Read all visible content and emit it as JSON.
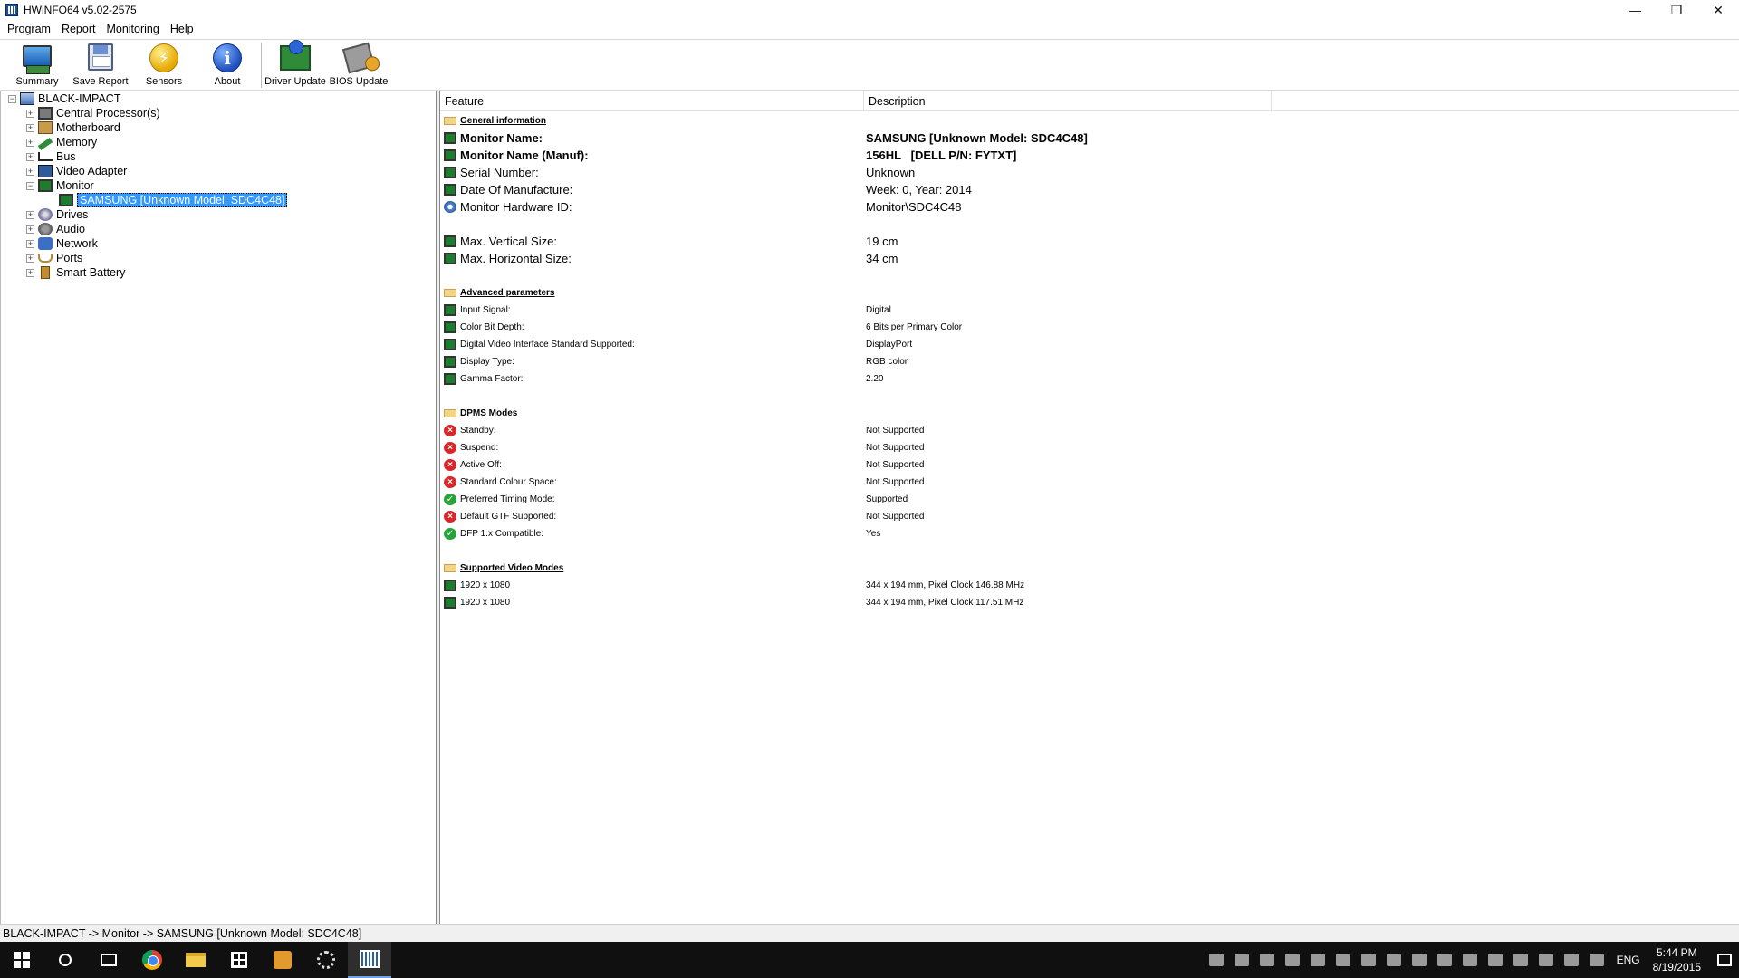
{
  "window": {
    "title": "HWiNFO64 v5.02-2575",
    "controls": [
      "—",
      "❐",
      "✕"
    ]
  },
  "menu": [
    "Program",
    "Report",
    "Monitoring",
    "Help"
  ],
  "toolbar": {
    "summary": "Summary",
    "save_report": "Save Report",
    "sensors": "Sensors",
    "about": "About",
    "driver_update": "Driver Update",
    "bios_update": "BIOS Update"
  },
  "tree": {
    "root": "BLACK-IMPACT",
    "items": [
      {
        "label": "Central Processor(s)",
        "icon": "cpu-icon"
      },
      {
        "label": "Motherboard",
        "icon": "motherboard-icon"
      },
      {
        "label": "Memory",
        "icon": "memory-icon"
      },
      {
        "label": "Bus",
        "icon": "bus-icon"
      },
      {
        "label": "Video Adapter",
        "icon": "video-adapter-icon"
      },
      {
        "label": "Monitor",
        "icon": "monitor-icon"
      },
      {
        "label": "Drives",
        "icon": "drives-icon"
      },
      {
        "label": "Audio",
        "icon": "audio-icon"
      },
      {
        "label": "Network",
        "icon": "network-icon"
      },
      {
        "label": "Ports",
        "icon": "ports-icon"
      },
      {
        "label": "Smart Battery",
        "icon": "battery-icon"
      }
    ],
    "monitor_child": "SAMSUNG [Unknown Model: SDC4C48]"
  },
  "table": {
    "col_feature": "Feature",
    "col_description": "Description",
    "general": {
      "title": "General information",
      "monitor_name_label": "Monitor Name:",
      "monitor_name_value": "SAMSUNG [Unknown Model: SDC4C48]",
      "monitor_name_manuf_label": "Monitor Name (Manuf):",
      "monitor_name_manuf_value": "156HL   [DELL P/N: FYTXT]",
      "serial_label": "Serial Number:",
      "serial_value": "Unknown",
      "date_label": "Date Of Manufacture:",
      "date_value": "Week: 0, Year: 2014",
      "hwid_label": "Monitor Hardware ID:",
      "hwid_value": "Monitor\\SDC4C48",
      "vsize_label": "Max. Vertical Size:",
      "vsize_value": "19 cm",
      "hsize_label": "Max. Horizontal Size:",
      "hsize_value": "34 cm"
    },
    "advanced": {
      "title": "Advanced parameters",
      "input_label": "Input Signal:",
      "input_value": "Digital",
      "depth_label": "Color Bit Depth:",
      "depth_value": "6 Bits per Primary Color",
      "dvi_label": "Digital Video Interface Standard Supported:",
      "dvi_value": "DisplayPort",
      "type_label": "Display Type:",
      "type_value": "RGB color",
      "gamma_label": "Gamma Factor:",
      "gamma_value": "2.20"
    },
    "dpms": {
      "title": "DPMS Modes",
      "standby_label": "Standby:",
      "standby_value": "Not Supported",
      "suspend_label": "Suspend:",
      "suspend_value": "Not Supported",
      "activeoff_label": "Active Off:",
      "activeoff_value": "Not Supported",
      "colour_label": "Standard Colour Space:",
      "colour_value": "Not Supported",
      "preferred_label": "Preferred Timing Mode:",
      "preferred_value": "Supported",
      "gtf_label": "Default GTF Supported:",
      "gtf_value": "Not Supported",
      "dfp_label": "DFP 1.x Compatible:",
      "dfp_value": "Yes"
    },
    "video_modes": {
      "title": "Supported Video Modes",
      "mode1_label": "1920 x 1080",
      "mode1_value": "344 x 194 mm, Pixel Clock 146.88 MHz",
      "mode2_label": "1920 x 1080",
      "mode2_value": "344 x 194 mm, Pixel Clock 117.51 MHz"
    }
  },
  "statusbar": "BLACK-IMPACT -> Monitor -> SAMSUNG [Unknown Model: SDC4C48]",
  "taskbar": {
    "lang": "ENG",
    "time": "5:44 PM",
    "date": "8/19/2015"
  }
}
